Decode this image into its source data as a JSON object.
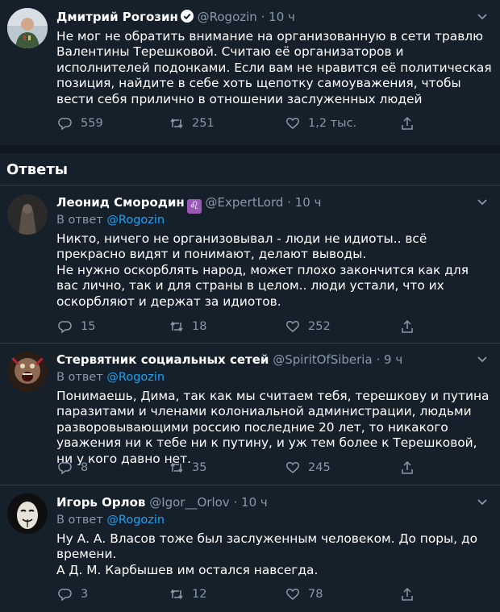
{
  "main_tweet": {
    "name": "Дмитрий Рогозин",
    "handle": "@Rogozin",
    "dot": "·",
    "time": "10 ч",
    "text": "Не мог не обратить внимание на организованную в сети травлю Валентины Терешковой. Считаю её организаторов и исполнителей подонками. Если вам не нравится её политическая позиция, найдите в себе хоть щепотку самоуважения, чтобы вести себя прилично в отношении заслуженных людей",
    "replies": "559",
    "retweets": "251",
    "likes": "1,2 тыс."
  },
  "section_title": "Ответы",
  "replies": [
    {
      "name": "Леонид Смородин",
      "handle": "@ExpertLord",
      "dot": "·",
      "time": "10 ч",
      "reply_prefix": "В ответ",
      "reply_to": "@Rogozin",
      "paragraphs": [
        "Никто, ничего не организовывал - люди не идиоты.. всё прекрасно видят и понимают, делают выводы.",
        "Не нужно оскорблять народ, может плохо закончится как для вас лично, так и для страны в целом.. люди устали, что их оскорбляют и держат за идиотов."
      ],
      "replies": "15",
      "retweets": "18",
      "likes": "252"
    },
    {
      "name": "Стервятник социальных сетей",
      "handle": "@SpiritOfSiberia",
      "dot": "·",
      "time": "9 ч",
      "reply_prefix": "В ответ",
      "reply_to": "@Rogozin",
      "paragraphs": [
        "Понимаешь, Дима, так как мы считаем тебя, терешкову и путина паразитами и членами колониальной администрации, людьми разворовывающими россию последние 20 лет, то никакого уважения ни к тебе ни к путину, и уж тем более к Терешковой, ни у кого давно нет."
      ],
      "replies": "8",
      "retweets": "35",
      "likes": "245"
    },
    {
      "name": "Игорь Орлов",
      "handle": "@Igor__Orlov",
      "dot": "·",
      "time": "10 ч",
      "reply_prefix": "В ответ",
      "reply_to": "@Rogozin",
      "paragraphs": [
        "Ну А. А. Власов тоже был заслуженным человеком. До поры, до времени.",
        "А Д. М. Карбышев им остался навсегда."
      ],
      "replies": "3",
      "retweets": "12",
      "likes": "78"
    }
  ],
  "colors": {
    "background": "#15202b",
    "text": "#ffffff",
    "muted": "#8899a6",
    "link": "#1da1f2",
    "border": "#38444d"
  }
}
